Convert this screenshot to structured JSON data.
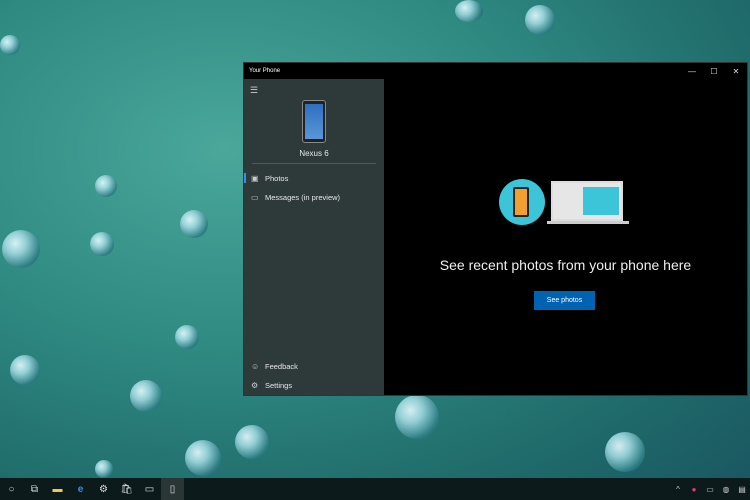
{
  "window": {
    "title": "Your Phone",
    "minimize": "—",
    "maximize": "☐",
    "close": "✕"
  },
  "sidebar": {
    "device_name": "Nexus 6",
    "items": [
      {
        "label": "Photos",
        "icon": "photo-icon"
      },
      {
        "label": "Messages (in preview)",
        "icon": "message-icon"
      }
    ],
    "bottom": [
      {
        "label": "Feedback",
        "icon": "feedback-icon"
      },
      {
        "label": "Settings",
        "icon": "gear-icon"
      }
    ]
  },
  "main": {
    "heading": "See recent photos from your phone here",
    "button": "See photos"
  },
  "colors": {
    "accent": "#0063b1",
    "sidebar": "#2d3a39"
  }
}
